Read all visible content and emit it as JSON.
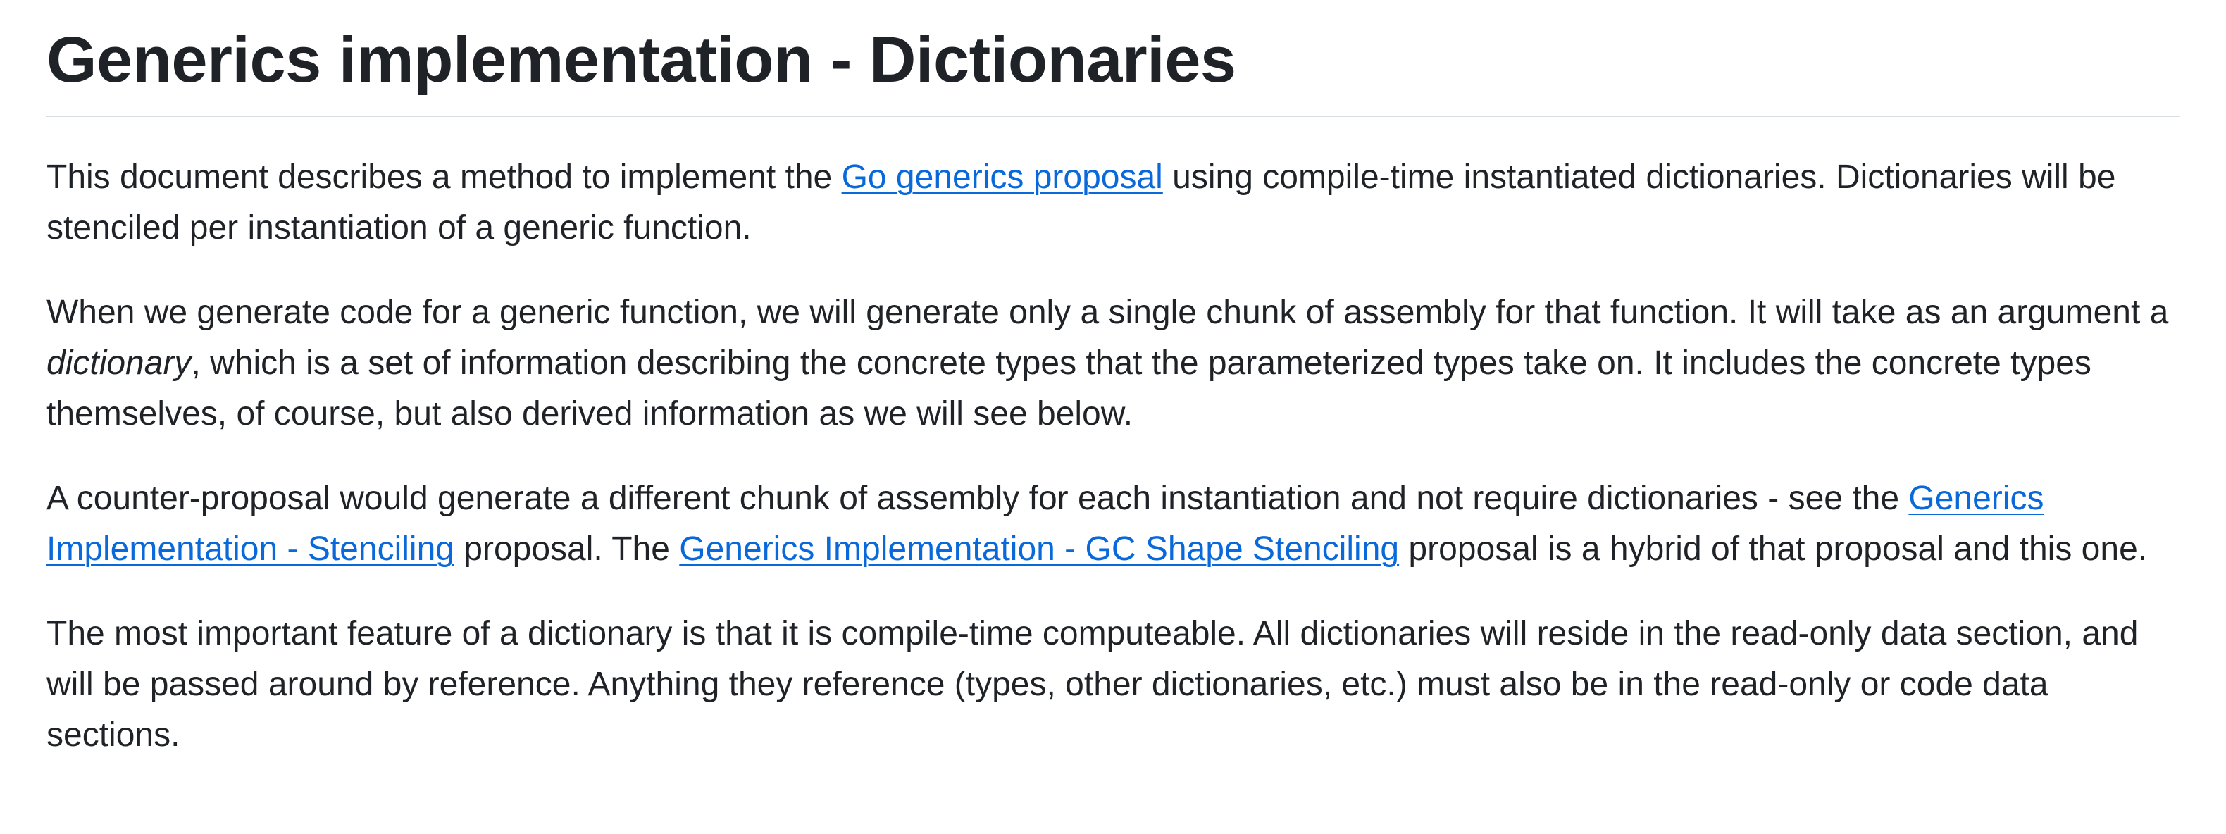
{
  "heading": "Generics implementation - Dictionaries",
  "colors": {
    "text": "#1f2328",
    "link": "#0969da",
    "divider": "#d8dee4"
  },
  "paragraphs": {
    "p1": {
      "before": "This document describes a method to implement the ",
      "link": "Go generics proposal",
      "after": " using compile-time instantiated dictionaries. Dictionaries will be stenciled per instantiation of a generic function."
    },
    "p2": {
      "before": "When we generate code for a generic function, we will generate only a single chunk of assembly for that function. It will take as an argument a ",
      "emphasis": "dictionary",
      "after": ", which is a set of information describing the concrete types that the parameterized types take on. It includes the concrete types themselves, of course, but also derived information as we will see below."
    },
    "p3": {
      "before": "A counter-proposal would generate a different chunk of assembly for each instantiation and not require dictionaries - see the ",
      "link1": "Generics Implementation - Stenciling",
      "middle": " proposal. The ",
      "link2": "Generics Implementation - GC Shape Stenciling",
      "after": " proposal is a hybrid of that proposal and this one."
    },
    "p4": {
      "text": "The most important feature of a dictionary is that it is compile-time computeable. All dictionaries will reside in the read-only data section, and will be passed around by reference. Anything they reference (types, other dictionaries, etc.) must also be in the read-only or code data sections."
    }
  }
}
